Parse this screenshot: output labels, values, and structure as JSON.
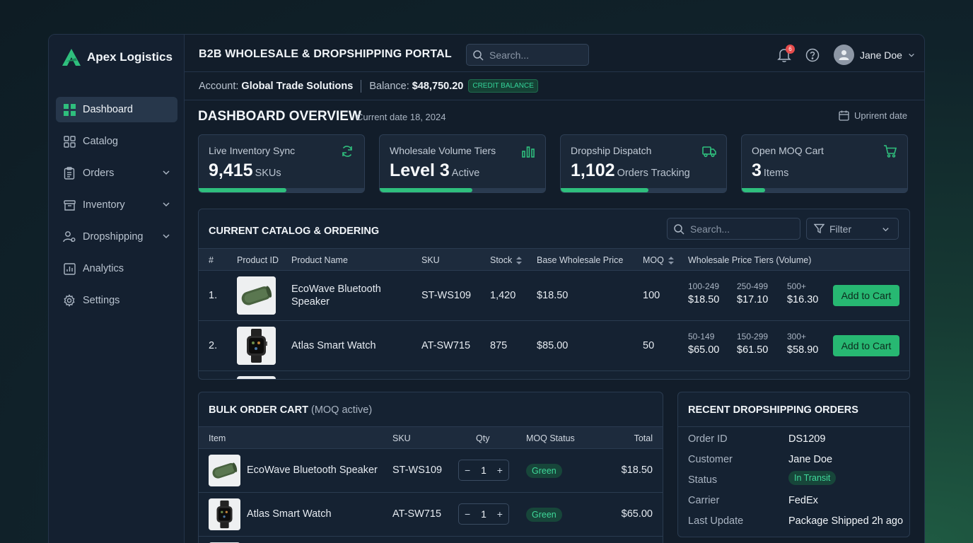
{
  "app": {
    "brand": "Apex Logistics",
    "portal_title": "B2B WHOLESALE & DROPSHIPPING PORTAL",
    "search_placeholder": "Search...",
    "notifications_count": "6",
    "user_name": "Jane Doe"
  },
  "sidebar": {
    "items": [
      {
        "label": "Dashboard",
        "icon": "grid-icon",
        "active": true
      },
      {
        "label": "Catalog",
        "icon": "catalog-icon"
      },
      {
        "label": "Orders",
        "icon": "clipboard-icon",
        "expandable": true
      },
      {
        "label": "Inventory",
        "icon": "box-icon",
        "expandable": true
      },
      {
        "label": "Dropshipping",
        "icon": "user-network-icon",
        "expandable": true
      },
      {
        "label": "Analytics",
        "icon": "chart-icon"
      },
      {
        "label": "Settings",
        "icon": "gear-icon"
      }
    ]
  },
  "account": {
    "account_label": "Account:",
    "account_name": "Global Trade Solutions",
    "balance_label": "Balance:",
    "balance_value": "$48,750.20",
    "balance_tag": "CREDIT BALANCE"
  },
  "overview": {
    "title": "DASHBOARD OVERVIEW",
    "current_date": "Current date 18, 2024",
    "date_button": "Uprirent date"
  },
  "kpis": [
    {
      "label": "Live Inventory Sync",
      "value": "9,415",
      "unit": "SKUs",
      "icon": "sync-icon",
      "progress": 0.53
    },
    {
      "label": "Wholesale Volume Tiers",
      "value": "Level 3",
      "unit": "Active",
      "icon": "bar-chart-icon",
      "progress": 0.56
    },
    {
      "label": "Dropship Dispatch",
      "value": "1,102",
      "unit": "Orders Tracking",
      "icon": "truck-icon",
      "progress": 0.53
    },
    {
      "label": "Open MOQ Cart",
      "value": "3",
      "unit": "Items",
      "icon": "cart-icon",
      "progress": 0.14
    }
  ],
  "catalog": {
    "title": "CURRENT CATALOG & ORDERING",
    "search_placeholder": "Search...",
    "filter_label": "Filter",
    "columns": {
      "num": "#",
      "product_id": "Product ID",
      "product_name": "Product Name",
      "sku": "SKU",
      "stock": "Stock",
      "base_price": "Base Wholesale Price",
      "moq": "MOQ",
      "tiers": "Wholesale Price Tiers (Volume)"
    },
    "rows": [
      {
        "num": "1.",
        "name_line1": "EcoWave Bluetooth",
        "name_line2": "Speaker",
        "sku": "ST-WS109",
        "stock": "1,420",
        "base_price": "$18.50",
        "moq": "100",
        "tiers": [
          {
            "range": "100-249",
            "price": "$18.50"
          },
          {
            "range": "250-499",
            "price": "$17.10"
          },
          {
            "range": "500+",
            "price": "$16.30"
          }
        ],
        "action": "Add to Cart"
      },
      {
        "num": "2.",
        "name_line1": "Atlas Smart Watch",
        "name_line2": "",
        "sku": "AT-SW715",
        "stock": "875",
        "base_price": "$85.00",
        "moq": "50",
        "tiers": [
          {
            "range": "50-149",
            "price": "$65.00"
          },
          {
            "range": "150-299",
            "price": "$61.50"
          },
          {
            "range": "300+",
            "price": "$58.90"
          }
        ],
        "action": "Add to Cart"
      }
    ]
  },
  "bulk_cart": {
    "title": "BULK ORDER CART",
    "title_note": "(MOQ active)",
    "columns": {
      "item": "Item",
      "sku": "SKU",
      "qty": "Qty",
      "moq_status": "MOQ Status",
      "total": "Total"
    },
    "rows": [
      {
        "item": "EcoWave Bluetooth Speaker",
        "sku": "ST-WS109",
        "qty": "1",
        "status": "Green",
        "total": "$18.50"
      },
      {
        "item": "Atlas Smart Watch",
        "sku": "AT-SW715",
        "qty": "1",
        "status": "Green",
        "total": "$65.00"
      }
    ]
  },
  "recent_orders": {
    "title": "RECENT DROPSHIPPING ORDERS",
    "fields": [
      {
        "key": "Order ID",
        "value": "DS1209"
      },
      {
        "key": "Customer",
        "value": "Jane Doe"
      },
      {
        "key": "Status",
        "value": "In Transit"
      },
      {
        "key": "Carrier",
        "value": "FedEx"
      },
      {
        "key": "Last Update",
        "value": "Package Shipped 2h ago"
      }
    ]
  },
  "colors": {
    "accent": "#27b872",
    "background": "#121d2a",
    "panel": "#152232"
  }
}
